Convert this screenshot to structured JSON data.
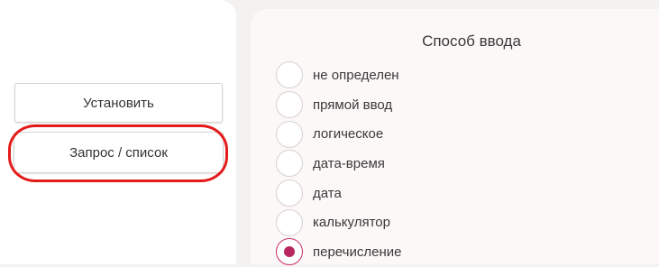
{
  "left_panel": {
    "install_label": "Установить",
    "query_list_label": "Запрос / список"
  },
  "input_method_panel": {
    "title": "Способ ввода",
    "selected": "перечисление",
    "options": [
      {
        "label": "не определен",
        "checked": false
      },
      {
        "label": "прямой ввод",
        "checked": false
      },
      {
        "label": "логическое",
        "checked": false
      },
      {
        "label": "дата-время",
        "checked": false
      },
      {
        "label": "дата",
        "checked": false
      },
      {
        "label": "калькулятор",
        "checked": false
      },
      {
        "label": "перечисление",
        "checked": true
      }
    ]
  },
  "colors": {
    "accent": "#b8285e",
    "highlight": "#e41b1b",
    "background": "#f4f2f1"
  }
}
